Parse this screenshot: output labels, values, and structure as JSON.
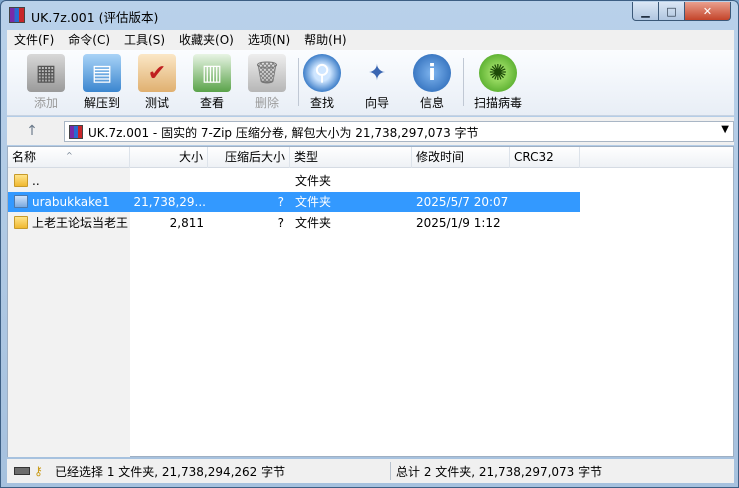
{
  "window": {
    "title": "UK.7z.001 (评估版本)"
  },
  "controls": {
    "minimize": "▁",
    "maximize": "□",
    "close": "✕"
  },
  "menu": [
    "文件(F)",
    "命令(C)",
    "工具(S)",
    "收藏夹(O)",
    "选项(N)",
    "帮助(H)"
  ],
  "toolbar": [
    {
      "label": "添加",
      "icon": "add-icon",
      "disabled": true
    },
    {
      "label": "解压到",
      "icon": "extract-folder-icon",
      "disabled": false
    },
    {
      "label": "测试",
      "icon": "test-clipboard-icon",
      "disabled": false
    },
    {
      "label": "查看",
      "icon": "view-book-icon",
      "disabled": false
    },
    {
      "label": "删除",
      "icon": "trash-icon",
      "disabled": true
    },
    {
      "label": "查找",
      "icon": "magnifier-icon",
      "disabled": false
    },
    {
      "label": "向导",
      "icon": "wizard-wand-icon",
      "disabled": false
    },
    {
      "label": "信息",
      "icon": "info-icon",
      "disabled": false
    },
    {
      "label": "扫描病毒",
      "icon": "virus-scan-icon",
      "disabled": false
    }
  ],
  "address": {
    "up": "↑",
    "text": "UK.7z.001 - 固实的 7-Zip 压缩分卷, 解包大小为 21,738,297,073 字节",
    "dropdown": "▼"
  },
  "columns": [
    "名称",
    "大小",
    "压缩后大小",
    "类型",
    "修改时间",
    "CRC32"
  ],
  "sort_indicator": "^",
  "rows": [
    {
      "name": "..",
      "size": "",
      "packed": "",
      "type": "文件夹",
      "modified": "",
      "crc": "",
      "selected": false,
      "icon": "folder-up-icon"
    },
    {
      "name": "urabukkake1",
      "size": "21,738,29...",
      "packed": "?",
      "type": "文件夹",
      "modified": "2025/5/7 20:07",
      "crc": "",
      "selected": true,
      "icon": "folder-blue-icon"
    },
    {
      "name": "上老王论坛当老王",
      "size": "2,811",
      "packed": "?",
      "type": "文件夹",
      "modified": "2025/1/9 1:12",
      "crc": "",
      "selected": false,
      "icon": "folder-icon"
    }
  ],
  "status": {
    "left": "已经选择 1 文件夹, 21,738,294,262 字节",
    "right": "总计 2 文件夹, 21,738,297,073 字节"
  }
}
